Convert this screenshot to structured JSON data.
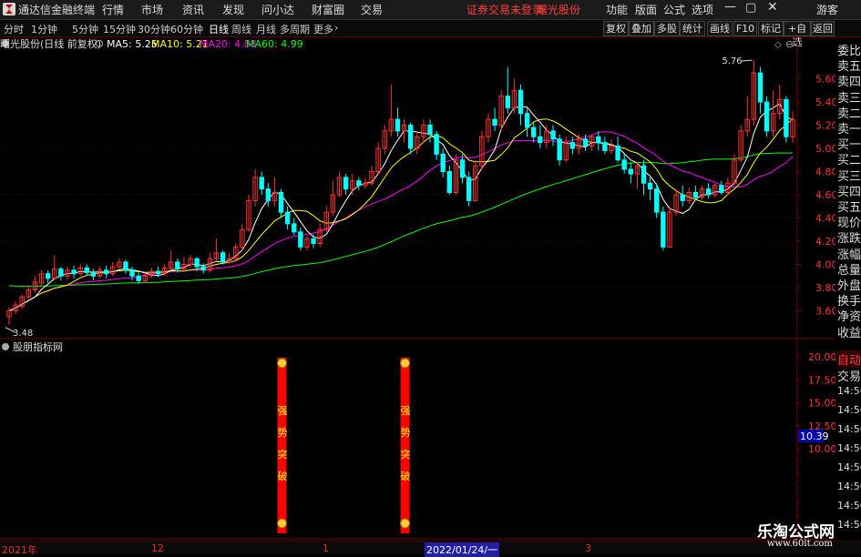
{
  "titlebar": {
    "app_name": "通达信金融终端",
    "menu": [
      "行情",
      "市场",
      "资讯",
      "发现",
      "问小达",
      "财富圈",
      "交易"
    ],
    "notice": "证券交易未登录",
    "stock": "曙光股份",
    "right_menu": [
      "功能",
      "版面",
      "公式",
      "选项"
    ],
    "user": "游客"
  },
  "toolbar": {
    "periods": [
      "分时",
      "1分钟",
      "5分钟",
      "15分钟",
      "30分钟",
      "60分钟",
      "日线",
      "周线",
      "月线",
      "多周期",
      "更多"
    ],
    "active_period": "日线",
    "right_buttons": [
      "复权",
      "叠加",
      "多股",
      "统计",
      "画线",
      "F10",
      "标记",
      "+自选",
      "返回"
    ]
  },
  "main_panel": {
    "title": "曙光股份(日线 前复权)",
    "ma": [
      {
        "label": "MA5: 5.25",
        "color": "#ffffff"
      },
      {
        "label": "MA10: 5.21",
        "color": "#ffff00"
      },
      {
        "label": "MA20: 4.88",
        "color": "#ff00ff"
      },
      {
        "label": "MA60: 4.99",
        "color": "#00ff00"
      }
    ],
    "high_mark": "5.76",
    "low_mark": "3.48",
    "price_ticks": [
      "5.60",
      "5.40",
      "5.20",
      "5.00",
      "4.80",
      "4.60",
      "4.40",
      "4.20",
      "4.00",
      "3.80",
      "3.60"
    ]
  },
  "sub_panel": {
    "title": "股朋指标网",
    "ticks": [
      "20.00",
      "17.50",
      "15.00",
      "12.50",
      "10.00"
    ],
    "current_value": "10.39",
    "signal_text": [
      "强",
      "势",
      "突",
      "破"
    ]
  },
  "right_sidebar": {
    "labels": [
      "委比",
      "卖五",
      "卖四",
      "卖三",
      "卖二",
      "卖一",
      "买一",
      "买二",
      "买三",
      "买四",
      "买五",
      "现价",
      "涨跌",
      "涨幅",
      "总量",
      "外盘",
      "换手",
      "净资",
      "收益"
    ],
    "auto_label": "自动",
    "trade_label": "交易",
    "times": [
      "14:56",
      "14:56",
      "14:56",
      "14:56",
      "14:56",
      "14:56",
      "14:56",
      "14:56"
    ]
  },
  "bottom_axis": {
    "labels": [
      "2021年",
      "12",
      "1",
      "2022/01/24/一",
      "3"
    ]
  },
  "watermark": {
    "text": "乐淘公式网",
    "url": "www.60lt.com"
  },
  "colors": {
    "up": "#ff3232",
    "down": "#00ffff",
    "ma5": "#ffffff",
    "ma10": "#ffff00",
    "ma20": "#ff00ff",
    "ma60": "#00ff00",
    "grid_red": "#7a0000",
    "signal": "#ff0000"
  },
  "chart_data": {
    "type": "candlestick",
    "y_range": [
      3.4,
      5.8
    ],
    "candles": [
      {
        "o": 3.55,
        "c": 3.6,
        "h": 3.63,
        "l": 3.48
      },
      {
        "o": 3.6,
        "c": 3.65,
        "h": 3.68,
        "l": 3.57
      },
      {
        "o": 3.64,
        "c": 3.72,
        "h": 3.74,
        "l": 3.62
      },
      {
        "o": 3.72,
        "c": 3.78,
        "h": 3.82,
        "l": 3.7
      },
      {
        "o": 3.78,
        "c": 3.85,
        "h": 3.9,
        "l": 3.76
      },
      {
        "o": 3.84,
        "c": 3.92,
        "h": 3.95,
        "l": 3.82
      },
      {
        "o": 3.92,
        "c": 3.88,
        "h": 3.95,
        "l": 3.84
      },
      {
        "o": 3.88,
        "c": 3.96,
        "h": 4.08,
        "l": 3.86
      },
      {
        "o": 3.96,
        "c": 3.9,
        "h": 3.98,
        "l": 3.86
      },
      {
        "o": 3.9,
        "c": 3.95,
        "h": 3.98,
        "l": 3.87
      },
      {
        "o": 3.95,
        "c": 3.92,
        "h": 3.99,
        "l": 3.88
      },
      {
        "o": 3.92,
        "c": 3.97,
        "h": 4.0,
        "l": 3.9
      },
      {
        "o": 3.97,
        "c": 3.93,
        "h": 4.0,
        "l": 3.9
      },
      {
        "o": 3.93,
        "c": 3.9,
        "h": 3.96,
        "l": 3.86
      },
      {
        "o": 3.9,
        "c": 3.95,
        "h": 3.98,
        "l": 3.88
      },
      {
        "o": 3.95,
        "c": 3.92,
        "h": 3.99,
        "l": 3.88
      },
      {
        "o": 3.92,
        "c": 3.98,
        "h": 4.02,
        "l": 3.9
      },
      {
        "o": 3.98,
        "c": 4.02,
        "h": 4.05,
        "l": 3.96
      },
      {
        "o": 4.02,
        "c": 3.95,
        "h": 4.04,
        "l": 3.92
      },
      {
        "o": 3.95,
        "c": 3.9,
        "h": 3.98,
        "l": 3.86
      },
      {
        "o": 3.9,
        "c": 3.86,
        "h": 3.93,
        "l": 3.83
      },
      {
        "o": 3.86,
        "c": 3.9,
        "h": 3.93,
        "l": 3.84
      },
      {
        "o": 3.9,
        "c": 3.94,
        "h": 3.97,
        "l": 3.88
      },
      {
        "o": 3.94,
        "c": 3.92,
        "h": 3.98,
        "l": 3.89
      },
      {
        "o": 3.92,
        "c": 3.97,
        "h": 4.0,
        "l": 3.9
      },
      {
        "o": 3.97,
        "c": 4.02,
        "h": 4.12,
        "l": 3.95
      },
      {
        "o": 4.02,
        "c": 3.96,
        "h": 4.05,
        "l": 3.93
      },
      {
        "o": 3.96,
        "c": 4.0,
        "h": 4.06,
        "l": 3.94
      },
      {
        "o": 4.0,
        "c": 4.05,
        "h": 4.08,
        "l": 3.97
      },
      {
        "o": 4.05,
        "c": 3.98,
        "h": 4.06,
        "l": 3.94
      },
      {
        "o": 3.98,
        "c": 3.95,
        "h": 4.01,
        "l": 3.92
      },
      {
        "o": 3.95,
        "c": 4.05,
        "h": 4.1,
        "l": 3.93
      },
      {
        "o": 4.05,
        "c": 4.1,
        "h": 4.22,
        "l": 4.03
      },
      {
        "o": 4.1,
        "c": 4.02,
        "h": 4.12,
        "l": 4.0
      },
      {
        "o": 4.02,
        "c": 4.05,
        "h": 4.1,
        "l": 4.0
      },
      {
        "o": 4.05,
        "c": 4.15,
        "h": 4.18,
        "l": 4.03
      },
      {
        "o": 4.15,
        "c": 4.3,
        "h": 4.35,
        "l": 4.12
      },
      {
        "o": 4.3,
        "c": 4.55,
        "h": 4.6,
        "l": 4.28
      },
      {
        "o": 4.55,
        "c": 4.75,
        "h": 4.82,
        "l": 4.5
      },
      {
        "o": 4.75,
        "c": 4.65,
        "h": 4.8,
        "l": 4.6
      },
      {
        "o": 4.65,
        "c": 4.55,
        "h": 4.7,
        "l": 4.5
      },
      {
        "o": 4.55,
        "c": 4.62,
        "h": 4.75,
        "l": 4.5
      },
      {
        "o": 4.62,
        "c": 4.45,
        "h": 4.65,
        "l": 4.4
      },
      {
        "o": 4.45,
        "c": 4.35,
        "h": 4.5,
        "l": 4.3
      },
      {
        "o": 4.35,
        "c": 4.28,
        "h": 4.4,
        "l": 4.25
      },
      {
        "o": 4.28,
        "c": 4.15,
        "h": 4.32,
        "l": 4.12
      },
      {
        "o": 4.15,
        "c": 4.22,
        "h": 4.25,
        "l": 4.12
      },
      {
        "o": 4.22,
        "c": 4.18,
        "h": 4.26,
        "l": 4.14
      },
      {
        "o": 4.18,
        "c": 4.3,
        "h": 4.35,
        "l": 4.15
      },
      {
        "o": 4.3,
        "c": 4.45,
        "h": 4.5,
        "l": 4.28
      },
      {
        "o": 4.45,
        "c": 4.6,
        "h": 4.72,
        "l": 4.42
      },
      {
        "o": 4.6,
        "c": 4.75,
        "h": 4.8,
        "l": 4.58
      },
      {
        "o": 4.75,
        "c": 4.65,
        "h": 4.78,
        "l": 4.6
      },
      {
        "o": 4.65,
        "c": 4.72,
        "h": 4.78,
        "l": 4.6
      },
      {
        "o": 4.72,
        "c": 4.68,
        "h": 4.75,
        "l": 4.64
      },
      {
        "o": 4.68,
        "c": 4.7,
        "h": 4.75,
        "l": 4.65
      },
      {
        "o": 4.7,
        "c": 4.8,
        "h": 4.85,
        "l": 4.68
      },
      {
        "o": 4.8,
        "c": 5.0,
        "h": 5.05,
        "l": 4.78
      },
      {
        "o": 5.0,
        "c": 5.15,
        "h": 5.2,
        "l": 4.95
      },
      {
        "o": 5.15,
        "c": 5.25,
        "h": 5.55,
        "l": 5.1
      },
      {
        "o": 5.25,
        "c": 5.15,
        "h": 5.35,
        "l": 5.1
      },
      {
        "o": 5.15,
        "c": 5.2,
        "h": 5.25,
        "l": 5.05
      },
      {
        "o": 5.2,
        "c": 5.0,
        "h": 5.22,
        "l": 4.95
      },
      {
        "o": 5.0,
        "c": 5.1,
        "h": 5.15,
        "l": 4.95
      },
      {
        "o": 5.1,
        "c": 5.2,
        "h": 5.25,
        "l": 5.05
      },
      {
        "o": 5.2,
        "c": 5.12,
        "h": 5.25,
        "l": 5.05
      },
      {
        "o": 5.12,
        "c": 4.95,
        "h": 5.15,
        "l": 4.9
      },
      {
        "o": 4.95,
        "c": 4.8,
        "h": 5.0,
        "l": 4.75
      },
      {
        "o": 4.8,
        "c": 4.62,
        "h": 4.85,
        "l": 4.6
      },
      {
        "o": 4.62,
        "c": 4.9,
        "h": 4.95,
        "l": 4.6
      },
      {
        "o": 4.9,
        "c": 4.75,
        "h": 4.95,
        "l": 4.7
      },
      {
        "o": 4.75,
        "c": 4.55,
        "h": 4.8,
        "l": 4.5
      },
      {
        "o": 4.55,
        "c": 4.85,
        "h": 4.9,
        "l": 4.55
      },
      {
        "o": 4.85,
        "c": 5.1,
        "h": 5.15,
        "l": 4.82
      },
      {
        "o": 5.1,
        "c": 5.25,
        "h": 5.3,
        "l": 5.05
      },
      {
        "o": 5.25,
        "c": 5.2,
        "h": 5.35,
        "l": 5.15
      },
      {
        "o": 5.2,
        "c": 5.45,
        "h": 5.5,
        "l": 5.15
      },
      {
        "o": 5.45,
        "c": 5.35,
        "h": 5.7,
        "l": 5.3
      },
      {
        "o": 5.35,
        "c": 5.5,
        "h": 5.6,
        "l": 5.3
      },
      {
        "o": 5.5,
        "c": 5.3,
        "h": 5.55,
        "l": 5.2
      },
      {
        "o": 5.3,
        "c": 5.18,
        "h": 5.35,
        "l": 5.1
      },
      {
        "o": 5.18,
        "c": 5.1,
        "h": 5.22,
        "l": 5.05
      },
      {
        "o": 5.1,
        "c": 5.05,
        "h": 5.2,
        "l": 5.0
      },
      {
        "o": 5.05,
        "c": 5.15,
        "h": 5.2,
        "l": 5.0
      },
      {
        "o": 5.15,
        "c": 5.08,
        "h": 5.2,
        "l": 5.02
      },
      {
        "o": 5.08,
        "c": 4.9,
        "h": 5.12,
        "l": 4.85
      },
      {
        "o": 4.9,
        "c": 5.05,
        "h": 5.1,
        "l": 4.88
      },
      {
        "o": 5.05,
        "c": 5.0,
        "h": 5.1,
        "l": 4.95
      },
      {
        "o": 5.0,
        "c": 5.08,
        "h": 5.12,
        "l": 4.95
      },
      {
        "o": 5.08,
        "c": 5.02,
        "h": 5.12,
        "l": 4.98
      },
      {
        "o": 5.02,
        "c": 5.1,
        "h": 5.12,
        "l": 4.98
      },
      {
        "o": 5.1,
        "c": 5.05,
        "h": 5.15,
        "l": 4.98
      },
      {
        "o": 5.05,
        "c": 4.98,
        "h": 5.1,
        "l": 4.95
      },
      {
        "o": 4.98,
        "c": 5.02,
        "h": 5.08,
        "l": 4.95
      },
      {
        "o": 5.02,
        "c": 4.9,
        "h": 5.1,
        "l": 4.88
      },
      {
        "o": 4.9,
        "c": 4.82,
        "h": 4.95,
        "l": 4.78
      },
      {
        "o": 4.82,
        "c": 4.78,
        "h": 4.88,
        "l": 4.7
      },
      {
        "o": 4.78,
        "c": 4.85,
        "h": 4.88,
        "l": 4.65
      },
      {
        "o": 4.85,
        "c": 4.7,
        "h": 4.9,
        "l": 4.6
      },
      {
        "o": 4.7,
        "c": 4.65,
        "h": 4.75,
        "l": 4.55
      },
      {
        "o": 4.65,
        "c": 4.45,
        "h": 4.7,
        "l": 4.4
      },
      {
        "o": 4.45,
        "c": 4.15,
        "h": 4.5,
        "l": 4.12
      },
      {
        "o": 4.15,
        "c": 4.45,
        "h": 4.5,
        "l": 4.15
      },
      {
        "o": 4.45,
        "c": 4.6,
        "h": 4.65,
        "l": 4.42
      },
      {
        "o": 4.6,
        "c": 4.55,
        "h": 4.68,
        "l": 4.5
      },
      {
        "o": 4.55,
        "c": 4.62,
        "h": 4.66,
        "l": 4.52
      },
      {
        "o": 4.62,
        "c": 4.58,
        "h": 4.68,
        "l": 4.55
      },
      {
        "o": 4.58,
        "c": 4.65,
        "h": 4.68,
        "l": 4.56
      },
      {
        "o": 4.65,
        "c": 4.6,
        "h": 4.7,
        "l": 4.57
      },
      {
        "o": 4.6,
        "c": 4.68,
        "h": 4.7,
        "l": 4.58
      },
      {
        "o": 4.68,
        "c": 4.62,
        "h": 4.72,
        "l": 4.6
      },
      {
        "o": 4.62,
        "c": 4.7,
        "h": 4.75,
        "l": 4.6
      },
      {
        "o": 4.7,
        "c": 4.9,
        "h": 4.95,
        "l": 4.68
      },
      {
        "o": 4.9,
        "c": 5.15,
        "h": 5.2,
        "l": 4.88
      },
      {
        "o": 5.15,
        "c": 5.25,
        "h": 5.45,
        "l": 5.1
      },
      {
        "o": 5.25,
        "c": 5.65,
        "h": 5.76,
        "l": 5.2
      },
      {
        "o": 5.65,
        "c": 5.4,
        "h": 5.7,
        "l": 5.3
      },
      {
        "o": 5.4,
        "c": 5.15,
        "h": 5.45,
        "l": 5.1
      },
      {
        "o": 5.15,
        "c": 5.3,
        "h": 5.5,
        "l": 5.1
      },
      {
        "o": 5.3,
        "c": 5.42,
        "h": 5.55,
        "l": 5.25
      },
      {
        "o": 5.42,
        "c": 5.1,
        "h": 5.45,
        "l": 5.05
      },
      {
        "o": 5.1,
        "c": 5.25,
        "h": 5.32,
        "l": 5.05
      }
    ],
    "signals": [
      42,
      61
    ]
  }
}
